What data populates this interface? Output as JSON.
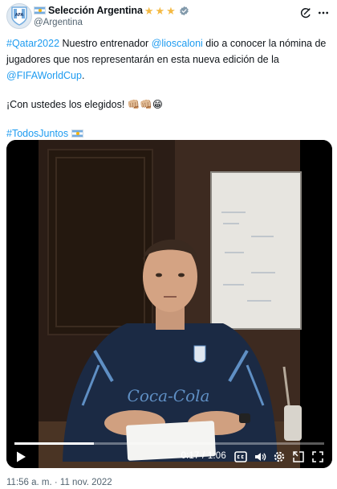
{
  "account": {
    "display_name": "Selección Argentina",
    "handle": "@Argentina",
    "stars": [
      "★",
      "★",
      "★"
    ],
    "avatar_icon": "afa-crest-icon",
    "flag_icon": "argentina-flag-icon",
    "verified_icon": "verified-badge-icon"
  },
  "header_actions": [
    "grok-icon",
    "more-options-icon"
  ],
  "tweet": {
    "hashtag_qatar": "#Qatar2022",
    "text_1": " Nuestro entrenador ",
    "mention_coach": "@lioscaloni",
    "text_2": " dio a conocer la nómina de jugadores que nos representarán en esta nueva edición de la ",
    "mention_fifa": "@FIFAWorldCup",
    "text_3": ".",
    "line_2": "¡Con ustedes los elegidos! 👊🏼👊🏼😁",
    "hashtag_todos": "#TodosJuntos",
    "link_color": "#1d9bf0"
  },
  "video": {
    "time_current": "0:17",
    "time_separator": " / ",
    "time_total": "1:06",
    "progress": 0.257,
    "shirt_brand": "Coca-Cola",
    "controls": [
      "play-icon",
      "captions-icon",
      "volume-icon",
      "settings-icon",
      "pip-icon",
      "fullscreen-icon"
    ]
  },
  "footer": {
    "timestamp": "11:56 a. m. · 11 nov. 2022"
  }
}
